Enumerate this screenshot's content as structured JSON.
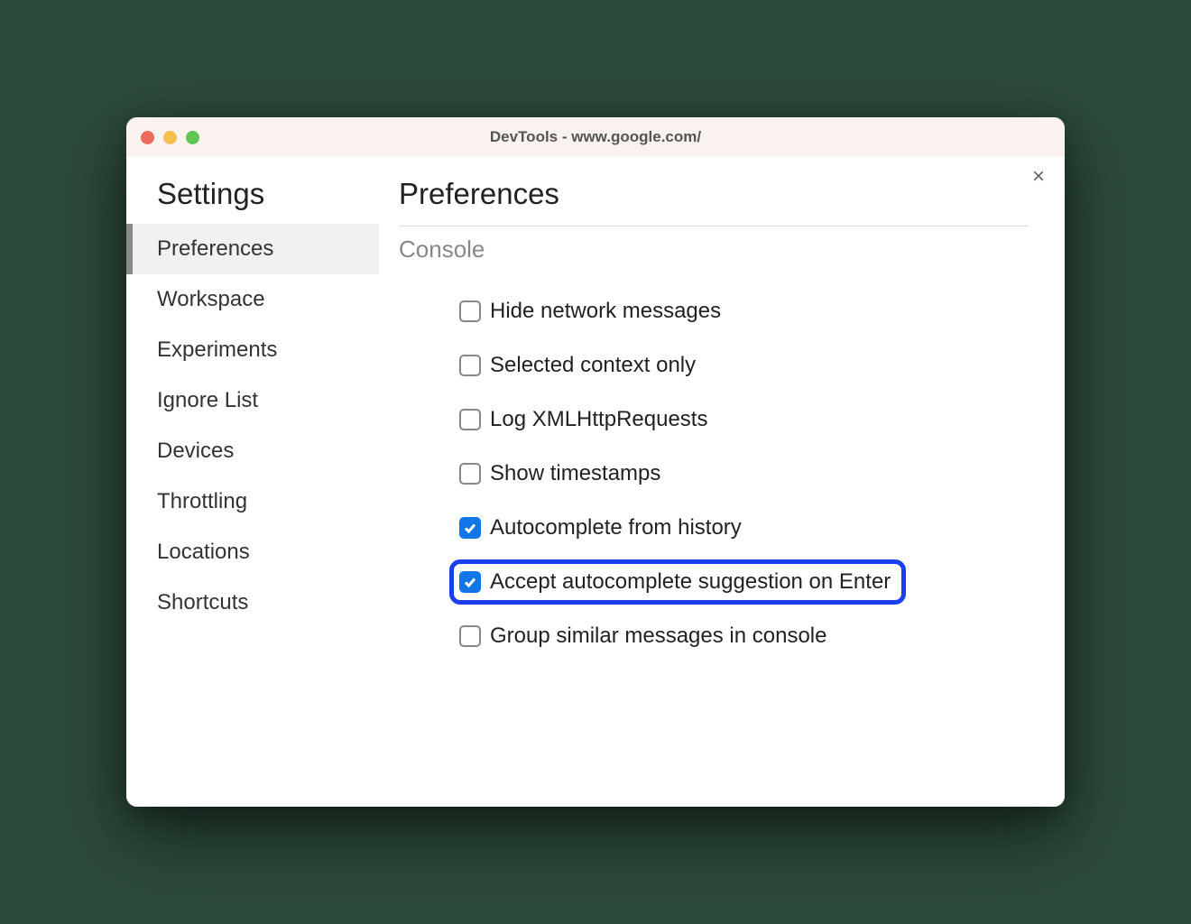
{
  "window": {
    "title": "DevTools - www.google.com/"
  },
  "sidebar": {
    "title": "Settings",
    "items": [
      {
        "label": "Preferences",
        "active": true
      },
      {
        "label": "Workspace",
        "active": false
      },
      {
        "label": "Experiments",
        "active": false
      },
      {
        "label": "Ignore List",
        "active": false
      },
      {
        "label": "Devices",
        "active": false
      },
      {
        "label": "Throttling",
        "active": false
      },
      {
        "label": "Locations",
        "active": false
      },
      {
        "label": "Shortcuts",
        "active": false
      }
    ]
  },
  "main": {
    "title": "Preferences",
    "section": "Console",
    "options": [
      {
        "label": "Hide network messages",
        "checked": false,
        "highlight": false
      },
      {
        "label": "Selected context only",
        "checked": false,
        "highlight": false
      },
      {
        "label": "Log XMLHttpRequests",
        "checked": false,
        "highlight": false
      },
      {
        "label": "Show timestamps",
        "checked": false,
        "highlight": false
      },
      {
        "label": "Autocomplete from history",
        "checked": true,
        "highlight": false
      },
      {
        "label": "Accept autocomplete suggestion on Enter",
        "checked": true,
        "highlight": true
      },
      {
        "label": "Group similar messages in console",
        "checked": false,
        "highlight": false
      }
    ]
  }
}
